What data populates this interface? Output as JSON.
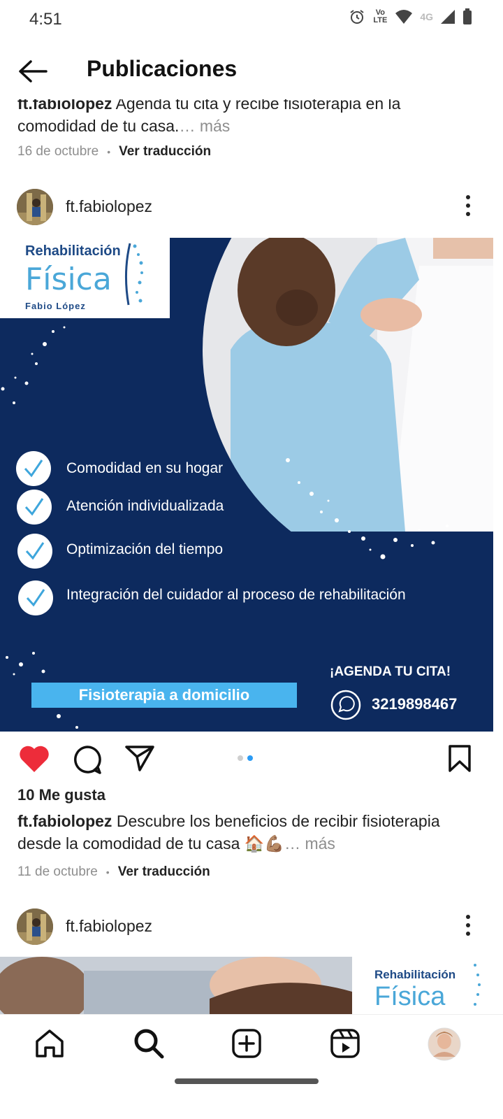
{
  "status_bar": {
    "time": "4:51",
    "indicators": [
      "alarm-icon",
      "volte-icon",
      "wifi-icon",
      "4g-icon",
      "signal-icon",
      "battery-icon"
    ],
    "volte_text": "Vo LTE",
    "network_text": "4G"
  },
  "header": {
    "title": "Publicaciones"
  },
  "previous_post": {
    "username": "ft.fabiolopez",
    "caption": "Agenda tu cita y recibe fisioterapia en la comodidad de tu casa.",
    "more": "… más",
    "date": "16 de octubre",
    "translate": "Ver traducción"
  },
  "post": {
    "username": "ft.fabiolopez",
    "image": {
      "logo_line1": "Rehabilitación",
      "logo_line2": "Física",
      "logo_line3": "Fabio López",
      "benefits": [
        "Comodidad en su hogar",
        "Atención individualizada",
        "Optimización del tiempo",
        "Integración del cuidador al proceso de rehabilitación"
      ],
      "banner": "Fisioterapia a domicilio",
      "cta": "¡AGENDA TU CITA!",
      "phone": "3219898467"
    },
    "carousel": {
      "count": 2,
      "active_index": 2
    },
    "likes": "10 Me gusta",
    "caption": "Descubre los beneficios de recibir fisioterapia desde la comodidad de tu casa 🏠💪🏽",
    "more": "… más",
    "date": "11 de octubre",
    "translate": "Ver traducción"
  },
  "next_post": {
    "username": "ft.fabiolopez",
    "logo_line1": "Rehabilitación",
    "logo_line2": "Física"
  },
  "bottom_nav": [
    "home-icon",
    "search-icon",
    "create-icon",
    "reels-icon",
    "profile-icon"
  ],
  "colors": {
    "accent": "#2b9bf4",
    "like": "#ed2c3a",
    "image_bg": "#0d2a5e",
    "check": "#3ea6dc",
    "banner": "#49b4ee"
  }
}
